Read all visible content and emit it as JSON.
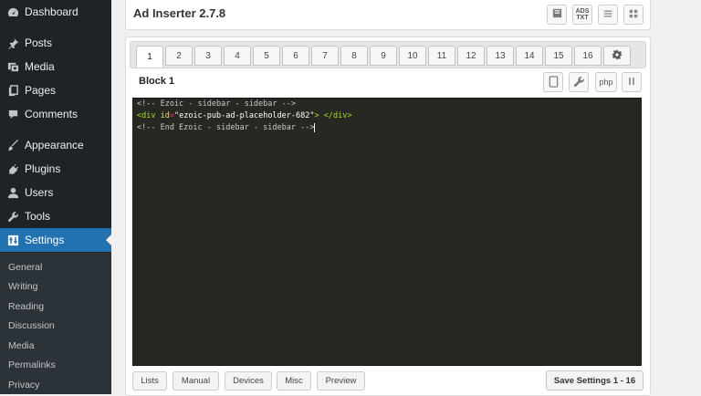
{
  "sidebar": {
    "items": [
      {
        "label": "Dashboard",
        "icon": "dashboard-icon"
      },
      {
        "label": "Posts",
        "icon": "pushpin-icon"
      },
      {
        "label": "Media",
        "icon": "media-icon"
      },
      {
        "label": "Pages",
        "icon": "pages-icon"
      },
      {
        "label": "Comments",
        "icon": "comment-icon"
      },
      {
        "label": "Appearance",
        "icon": "brush-icon"
      },
      {
        "label": "Plugins",
        "icon": "plug-icon"
      },
      {
        "label": "Users",
        "icon": "user-icon"
      },
      {
        "label": "Tools",
        "icon": "wrench-icon"
      },
      {
        "label": "Settings",
        "icon": "settings-icon"
      }
    ],
    "submenu": [
      "General",
      "Writing",
      "Reading",
      "Discussion",
      "Media",
      "Permalinks",
      "Privacy"
    ]
  },
  "header": {
    "title": "Ad Inserter 2.7.8",
    "ads_txt": [
      "ADS",
      "TXT"
    ]
  },
  "tabs": [
    "1",
    "2",
    "3",
    "4",
    "5",
    "6",
    "7",
    "8",
    "9",
    "10",
    "11",
    "12",
    "13",
    "14",
    "15",
    "16"
  ],
  "block": {
    "title": "Block 1",
    "php_label": "php"
  },
  "code": {
    "line1": "<!-- Ezoic - sidebar - sidebar -->",
    "line2_open": "<div ",
    "line2_attr": "id",
    "line2_eq": "=",
    "line2_val": "\"ezoic-pub-ad-placeholder-682\"",
    "line2_close": "> </div>",
    "line3": "<!-- End Ezoic - sidebar - sidebar -->"
  },
  "bottom_buttons": [
    "Lists",
    "Manual",
    "Devices",
    "Misc",
    "Preview"
  ],
  "save_label": "Save Settings 1 - 16",
  "colors": {
    "accent": "#2271b1",
    "sidebar_bg": "#1d2327",
    "editor_bg": "#272822"
  }
}
